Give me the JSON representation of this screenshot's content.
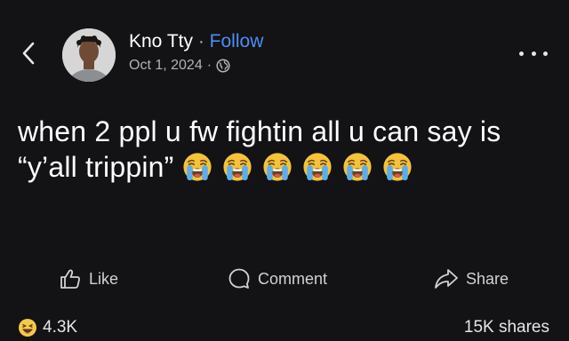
{
  "header": {
    "author_name": "Kno Tty",
    "separator": "·",
    "follow_label": "Follow",
    "date": "Oct 1, 2024",
    "meta_separator": "·",
    "audience_icon": "globe-icon",
    "back_icon": "chevron-left-icon",
    "more_icon": "more-horizontal-icon"
  },
  "post": {
    "text": "when 2 ppl u fw fightin all u can say is “y’all trippin”",
    "emoji_name": "loudly-crying-face-emoji",
    "emoji_count": 6
  },
  "actions": {
    "like_label": "Like",
    "comment_label": "Comment",
    "share_label": "Share"
  },
  "stats": {
    "reaction_count": "4.3K",
    "shares": "15K shares"
  },
  "colors": {
    "background": "#131214",
    "accent": "#4b8ff5",
    "text": "#ffffff"
  }
}
